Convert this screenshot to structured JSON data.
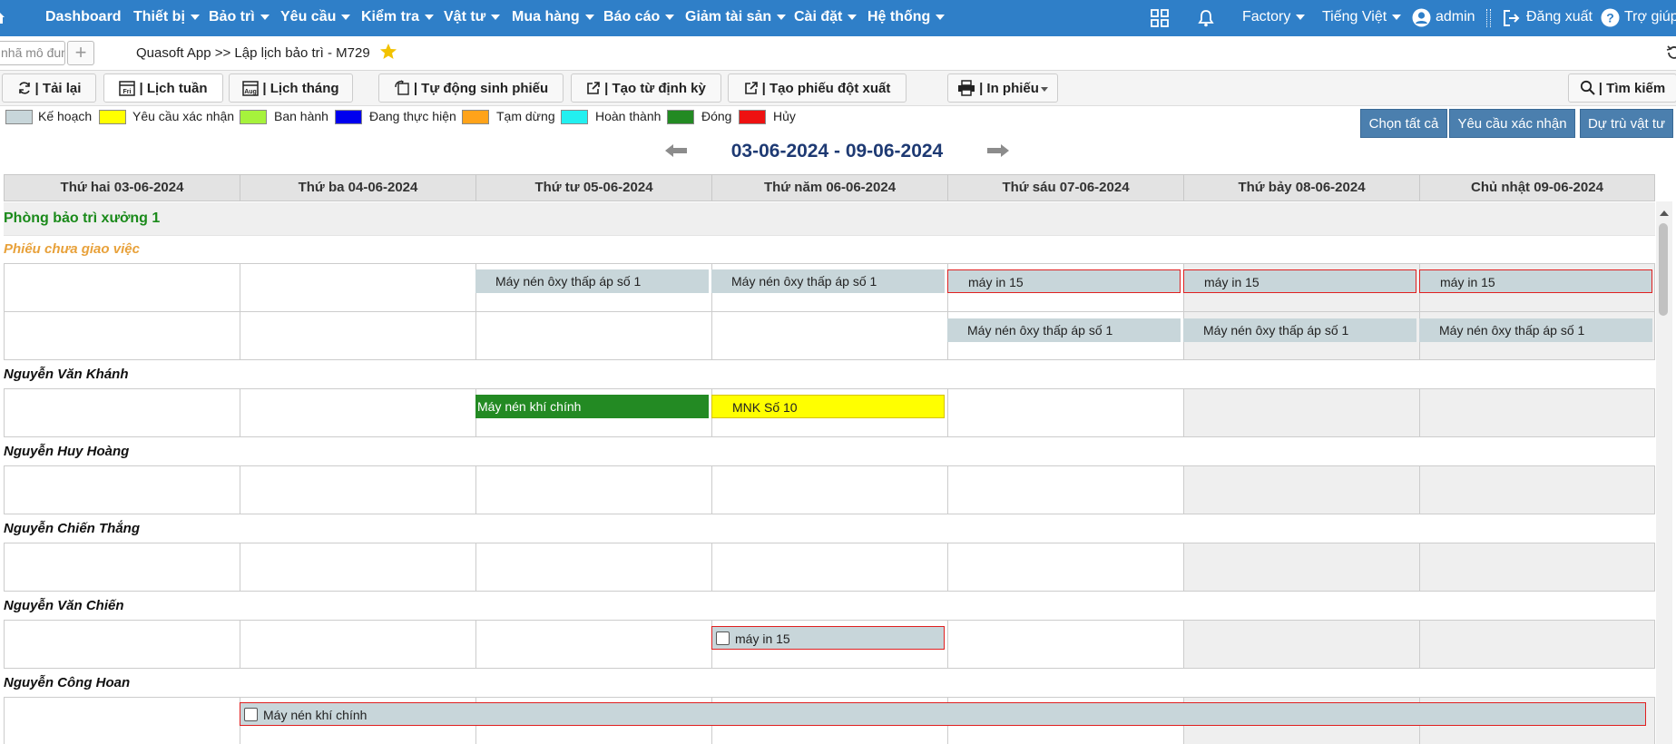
{
  "nav": {
    "items": [
      {
        "label": "Dashboard",
        "caret": false
      },
      {
        "label": "Thiết bị",
        "caret": true
      },
      {
        "label": "Bảo trì",
        "caret": true
      },
      {
        "label": "Yêu cầu",
        "caret": true
      },
      {
        "label": "Kiểm tra",
        "caret": true
      },
      {
        "label": "Vật tư",
        "caret": true
      },
      {
        "label": "Mua hàng",
        "caret": true
      },
      {
        "label": "Báo cáo",
        "caret": true
      },
      {
        "label": "Giảm tài sản",
        "caret": true
      },
      {
        "label": "Cài đặt",
        "caret": true
      },
      {
        "label": "Hệ thống",
        "caret": true
      }
    ],
    "factory": "Factory",
    "language": "Tiếng Việt",
    "user": "admin",
    "logout": "Đăng xuất",
    "help": "Trợ giúp"
  },
  "subbar": {
    "search_placeholder": "nhã mô đun",
    "breadcrumb": "Quasoft App >> Lập lịch bảo trì - M729"
  },
  "toolbar": {
    "reload": "| Tải lại",
    "week": "| Lịch tuần",
    "month": "| Lịch tháng",
    "auto": "| Tự động sinh phiếu",
    "periodic": "| Tạo từ định kỳ",
    "adhoc": "| Tạo phiếu đột xuất",
    "print": "| In phiếu",
    "search": "| Tìm kiếm",
    "week_icon_text": "Fri",
    "month_icon_text": "Aug"
  },
  "legend": [
    {
      "label": "Kế hoạch",
      "color": "#c8d6da"
    },
    {
      "label": "Yêu cầu xác nhận",
      "color": "#ffff00"
    },
    {
      "label": "Ban hành",
      "color": "#a6f23c"
    },
    {
      "label": "Đang thực hiện",
      "color": "#0000ee"
    },
    {
      "label": "Tạm dừng",
      "color": "#ffa31a"
    },
    {
      "label": "Hoàn thành",
      "color": "#22f0f0"
    },
    {
      "label": "Đóng",
      "color": "#238a23"
    },
    {
      "label": "Hủy",
      "color": "#ee1111"
    }
  ],
  "actions": {
    "select_all": "Chọn tất cả",
    "request_confirm": "Yêu cầu xác nhận",
    "reserve": "Dự trù vật tư"
  },
  "week": {
    "range": "03-06-2024 - 09-06-2024",
    "days": [
      "Thứ hai 03-06-2024",
      "Thứ ba 04-06-2024",
      "Thứ tư 05-06-2024",
      "Thứ năm 06-06-2024",
      "Thứ sáu 07-06-2024",
      "Thứ bảy 08-06-2024",
      "Chủ nhật 09-06-2024"
    ]
  },
  "schedule": {
    "group": "Phòng bảo trì xưởng 1",
    "unassigned": "Phiếu chưa giao việc",
    "people": [
      "Nguyễn Văn Khánh",
      "Nguyễn Huy Hoàng",
      "Nguyễn Chiến Thắng",
      "Nguyễn Văn Chiến",
      "Nguyễn Công Hoan"
    ],
    "tasks": {
      "t1": "Máy nén ôxy thấp áp số 1",
      "t2": "Máy nén ôxy thấp áp số 1",
      "t3": "máy in 15",
      "t4": "máy in 15",
      "t5": "máy in 15",
      "t6": "Máy nén ôxy thấp áp số 1",
      "t7": "Máy nén ôxy thấp áp số 1",
      "t8": "Máy nén ôxy thấp áp số 1",
      "t9": "Máy nén khí chính",
      "t10": "MNK Số 10",
      "t11": "máy in 15",
      "t12": "Máy nén khí chính"
    }
  }
}
